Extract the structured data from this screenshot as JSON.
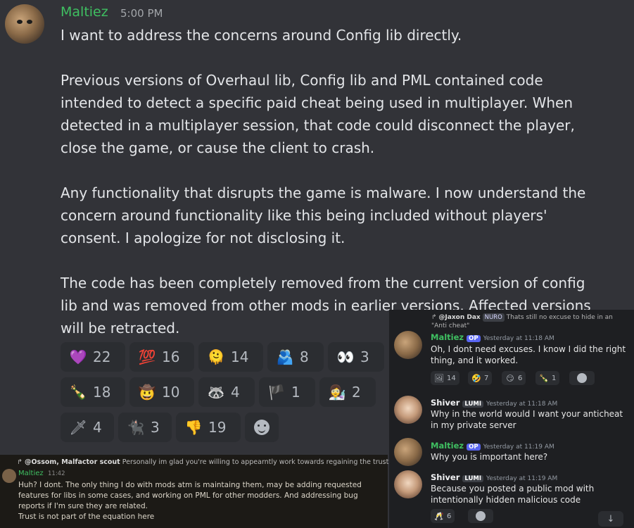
{
  "message": {
    "author": "Maltiez",
    "time": "5:00 PM",
    "paragraphs": [
      "I want to address the concerns around Config lib directly.",
      "Previous versions of Overhaul lib, Config lib and PML contained code intended to detect a specific paid cheat being used in multiplayer. When detected in a multiplayer session, that code could disconnect the player, close the game, or cause the client to crash.",
      "Any functionality that disrupts the game is malware. I now understand the concern around functionality like this being included without players' consent. I apologize for not disclosing it.",
      "The code has been completely removed from the current version of config lib and was removed from other mods in earlier versions. Affected versions will be retracted."
    ]
  },
  "reactions": [
    {
      "icon": "purple-heart-icon",
      "glyph": "💜",
      "count": "22"
    },
    {
      "icon": "hundred-icon",
      "glyph": "💯",
      "count": "16"
    },
    {
      "icon": "smiling-face-icon",
      "glyph": "🫠",
      "count": "14"
    },
    {
      "icon": "people-icon",
      "glyph": "🫂",
      "count": "8"
    },
    {
      "icon": "eyes-icon",
      "glyph": "👀",
      "count": "3"
    },
    {
      "icon": "bottle-icon",
      "glyph": "🍾",
      "count": "18"
    },
    {
      "icon": "cowboy-face-icon",
      "glyph": "🤠",
      "count": "10"
    },
    {
      "icon": "custom-emoji-icon",
      "glyph": "🦝",
      "count": "4"
    },
    {
      "icon": "wales-flag-icon",
      "glyph": "🏴",
      "count": "1"
    },
    {
      "icon": "scientist-icon",
      "glyph": "👩‍🔬",
      "count": "2"
    },
    {
      "icon": "custom-character-icon",
      "glyph": "🗡",
      "count": "4"
    },
    {
      "icon": "cat-emoji-icon",
      "glyph": "🐈‍⬛",
      "count": "3"
    },
    {
      "icon": "thumbs-down-icon",
      "glyph": "👎",
      "count": "19"
    }
  ],
  "overlay_left": {
    "reply_to": "@Ossom, Malfactor scout",
    "reply_text": "Personally im glad you're willing to appearntly work towards regaining the trust you broke",
    "author": "Maltiez",
    "time": "11:42",
    "lines": [
      "Huh? I dont. The only thing I do with mods atm is maintaing them, may be adding requested features for libs in some cases, and working on PML for other modders. And addressing bug reports if I'm sure they are related.",
      "Trust is not part of the equation here"
    ]
  },
  "overlay_right": {
    "reply_to": "@Jaxon Dax",
    "reply_tag": "NURO",
    "reply_text": "Thats still no excuse to hide in an \"Anti cheat\"",
    "messages": [
      {
        "author": "Maltiez",
        "tag": "OP",
        "time": "Yesterday at 11:18 AM",
        "text": "Oh, I dont need excuses. I know I did the right thing, and it worked."
      },
      {
        "author": "Shiver",
        "tag": "LUMI",
        "time": "Yesterday at 11:18 AM",
        "text": "Why in the world would I want your anticheat in my private server"
      },
      {
        "author": "Maltiez",
        "tag": "OP",
        "time": "Yesterday at 11:19 AM",
        "text": "Why you is important here?"
      },
      {
        "author": "Shiver",
        "tag": "LUMI",
        "time": "Yesterday at 11:19 AM",
        "text": "Because you posted a public mod with intentionally hidden malicious code"
      }
    ],
    "reactions_a": [
      {
        "icon": "custom-emoji-icon",
        "glyph": "🖼",
        "count": "14"
      },
      {
        "icon": "laughing-icon",
        "glyph": "🤣",
        "count": "7"
      },
      {
        "icon": "smirk-icon",
        "glyph": "😏",
        "count": "6"
      },
      {
        "icon": "bottle-icon",
        "glyph": "🍾",
        "count": "1"
      }
    ],
    "reactions_b": [
      {
        "icon": "cheers-icon",
        "glyph": "🥂",
        "count": "6"
      }
    ]
  },
  "colors": {
    "username_green": "#3fbf61",
    "background": "#313338",
    "reaction_bg": "#2b2d31"
  }
}
